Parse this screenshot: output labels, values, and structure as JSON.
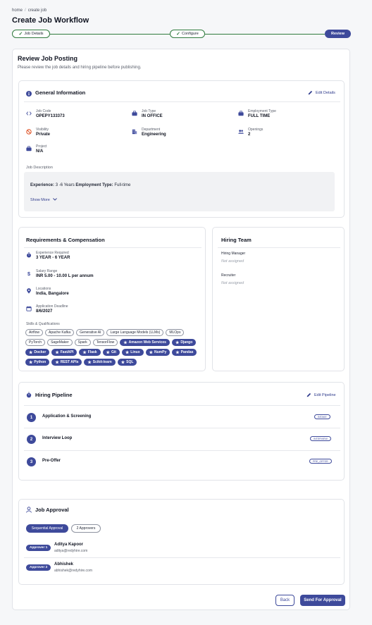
{
  "breadcrumb": {
    "home": "home",
    "current": "create job"
  },
  "page_title": "Create Job Workflow",
  "stepper": {
    "steps": [
      {
        "label": "Job Details",
        "state": "done"
      },
      {
        "label": "Configure",
        "state": "done"
      },
      {
        "label": "Review",
        "state": "active"
      }
    ],
    "check_glyph": "✓"
  },
  "review": {
    "title": "Review Job Posting",
    "subtitle": "Please review the job details and hiring pipeline before publishing."
  },
  "general": {
    "title": "General Information",
    "edit_label": "Edit Details",
    "fields": {
      "job_code": {
        "label": "Job Code",
        "value": "OPEPY133373"
      },
      "job_type": {
        "label": "Job Type",
        "value": "IN OFFICE"
      },
      "employment_type": {
        "label": "Employment Type",
        "value": "FULL TIME"
      },
      "visibility": {
        "label": "Visibility",
        "value": "Private"
      },
      "department": {
        "label": "Department",
        "value": "Engineering"
      },
      "openings": {
        "label": "Openings",
        "value": "2"
      },
      "project": {
        "label": "Project",
        "value": "N/A"
      }
    },
    "description_label": "Job Description",
    "description": {
      "exp_label": "Experience:",
      "exp_value": "3 -6 Years",
      "emp_label": "Employment Type:",
      "emp_value": "Full-time"
    },
    "show_more": "Show More"
  },
  "requirements": {
    "title": "Requirements & Compensation",
    "fields": {
      "experience": {
        "label": "Experience Required",
        "value": "3 YEAR - 6 YEAR"
      },
      "salary": {
        "label": "Salary Range",
        "value": "INR 5.00 - 10.00 L per annum"
      },
      "locations": {
        "label": "Locations",
        "value": "India, Bangalore"
      },
      "deadline": {
        "label": "Application Deadline",
        "value": "8/6/2027"
      }
    },
    "skills_label": "Skills & Qualifications",
    "skills": [
      "Airflow",
      "Apache Kafka",
      "Generative AI",
      "Large Language Models (LLMs)",
      "MLOps",
      "PyTorch",
      "SageMaker",
      "Spark",
      "TensorFlow"
    ],
    "starred_skills": [
      "Amazon Web Services",
      "Django",
      "Docker",
      "FastAPI",
      "Flask",
      "Git",
      "Linux",
      "NumPy",
      "Pandas",
      "Python",
      "REST APIs",
      "Scikit-learn",
      "SQL"
    ]
  },
  "hiring_team": {
    "title": "Hiring Team",
    "manager_label": "Hiring Manager",
    "manager_value": "Not assigned",
    "recruiter_label": "Recruiter",
    "recruiter_value": "Not assigned"
  },
  "pipeline": {
    "title": "Hiring Pipeline",
    "edit_label": "Edit Pipeline",
    "stages": [
      {
        "num": "1",
        "name": "Application & Screening",
        "badge": "INTAKE"
      },
      {
        "num": "2",
        "name": "Interview Loop",
        "badge": "INTERVIEW"
      },
      {
        "num": "3",
        "name": "Pre-Offer",
        "badge": "PRE_OFFER"
      }
    ]
  },
  "approval": {
    "title": "Job Approval",
    "mode": "Sequential Approval",
    "count": "2 Approvers",
    "approvers": [
      {
        "tag": "Approver 1",
        "name": "Aditya Kapoor",
        "email": "aditya@redyhire.com"
      },
      {
        "tag": "Approver 2",
        "name": "Abhishek",
        "email": "abhishek@redyhire.com"
      }
    ]
  },
  "actions": {
    "back": "Back",
    "send": "Send For Approval"
  },
  "colors": {
    "primary": "#3e4a9b",
    "success": "#2f7a3d",
    "danger": "#e0572b"
  }
}
